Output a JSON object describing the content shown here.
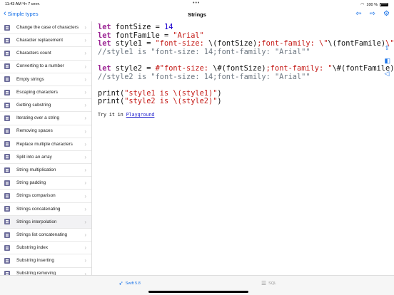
{
  "status": {
    "time": "11:43 AM",
    "date": "Чт 7 сент.",
    "battery": "100 %"
  },
  "nav": {
    "back_label": "Simple types",
    "title": "Strings"
  },
  "sidebar": {
    "items": [
      {
        "label": "Change the case of characters"
      },
      {
        "label": "Character replacement"
      },
      {
        "label": "Characters count"
      },
      {
        "label": "Converting to a number"
      },
      {
        "label": "Empty strings"
      },
      {
        "label": "Escaping characters"
      },
      {
        "label": "Getting substring"
      },
      {
        "label": "Iterating over a string"
      },
      {
        "label": "Removing spaces"
      },
      {
        "label": "Replace multiple characters"
      },
      {
        "label": "Split into an array"
      },
      {
        "label": "String multiplication"
      },
      {
        "label": "String padding"
      },
      {
        "label": "Strings comparison"
      },
      {
        "label": "Strings concatenating"
      },
      {
        "label": "Strings interpolation",
        "selected": true
      },
      {
        "label": "Strings list concatenating"
      },
      {
        "label": "Substring index"
      },
      {
        "label": "Substring inserting"
      },
      {
        "label": "Substring removing"
      }
    ]
  },
  "code": {
    "l1": {
      "kw": "let",
      "rest": " fontSize = ",
      "num": "14"
    },
    "l2": {
      "kw": "let",
      "rest": " fontFamile = ",
      "str": "\"Arial\""
    },
    "l3": {
      "kw": "let",
      "rest": " style1 = ",
      "s1": "\"font-size: ",
      "i1": "\\(fontSize)",
      "s2": ";font-family: \\\"",
      "i2": "\\(fontFamile)",
      "s3": "\\\"\""
    },
    "l4": "//style1 is \"font-size: 14;font-family: \"Arial\"\"",
    "l5": {
      "kw": "let",
      "rest": " style2 = ",
      "s1": "#\"font-size: ",
      "i1": "\\#(fontSize)",
      "s2": ";font-family: \"",
      "i2": "\\#(fontFamile)",
      "s3": "\"\"#"
    },
    "l6": "//style2 is \"font-size: 14;font-family: \"Arial\"\"",
    "l7": {
      "fn": "print(",
      "str": "\"style1 is \\(style1)\"",
      "end": ")"
    },
    "l8": {
      "fn": "print(",
      "str": "\"style2 is \\(style2)\"",
      "end": ")"
    }
  },
  "try": {
    "prefix": "Try it in ",
    "link": "Playground"
  },
  "tabs": {
    "swift": "Swift 5.8",
    "sql": "SQL"
  }
}
